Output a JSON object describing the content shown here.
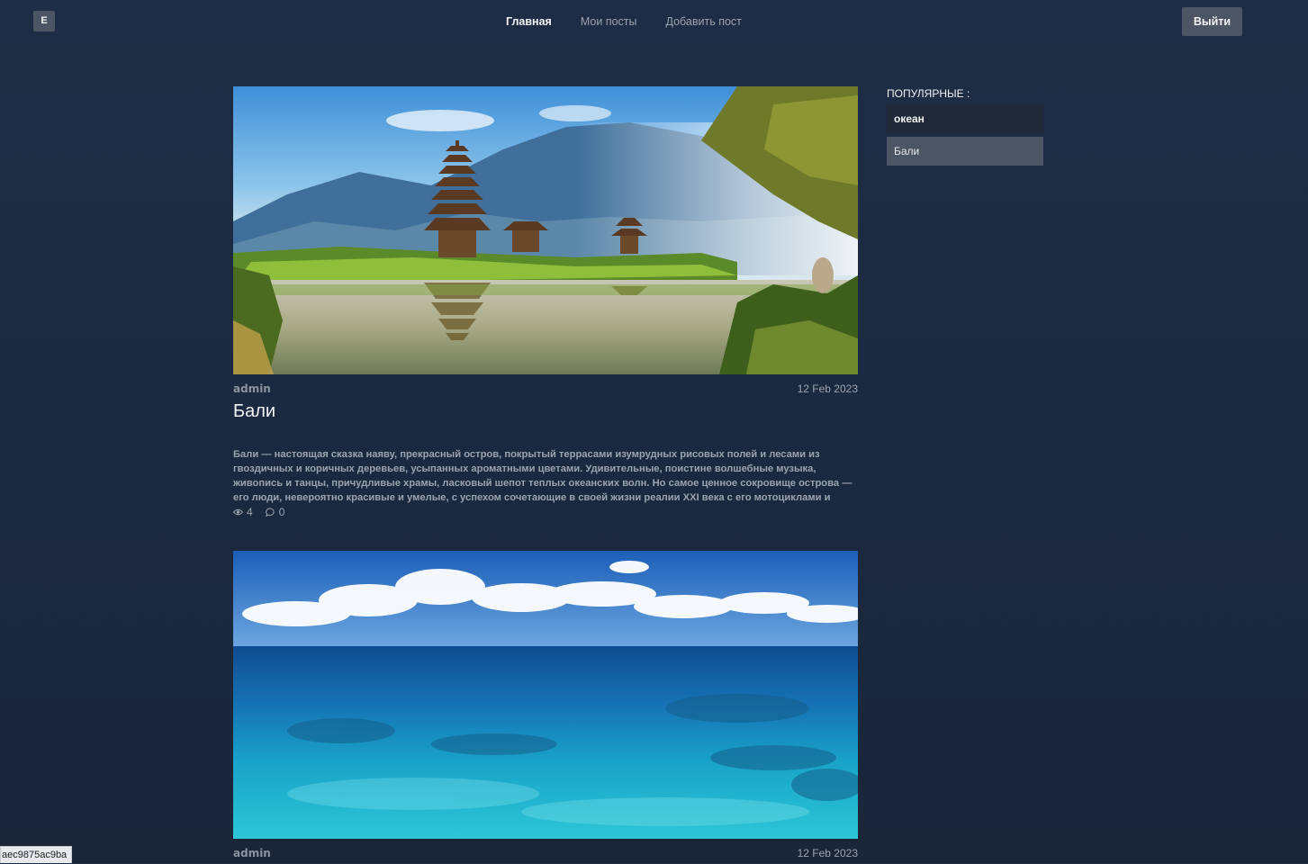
{
  "header": {
    "logo_letter": "E",
    "nav": [
      {
        "label": "Главная",
        "active": true
      },
      {
        "label": "Мои посты",
        "active": false
      },
      {
        "label": "Добавить пост",
        "active": false
      }
    ],
    "logout_label": "Выйти"
  },
  "posts": [
    {
      "image": "bali-temple-lake-photo",
      "author": "admin",
      "date": "12 Feb 2023",
      "title": "Бали",
      "excerpt": "Бали — настоящая сказка наяву, прекрасный остров, покрытый террасами изумрудных рисовых полей и лесами из гвоздичных и коричных деревьев, усыпанных ароматными цветами. Удивительные, поистине волшебные музыка, живопись и танцы, причудливые храмы, ласковый шепот теплых океанских волн. Но самое ценное сокровище острова — его люди, невероятно красивые и умелые, с успехом сочетающие в своей жизни реалии XXI века с его мотоциклами и интернет-каф...",
      "views": "4",
      "comments": "0"
    },
    {
      "image": "ocean-photo",
      "author": "admin",
      "date": "12 Feb 2023"
    }
  ],
  "sidebar": {
    "title": "ПОПУЛЯРНЫЕ :",
    "tags": [
      "океан",
      "Бали"
    ]
  },
  "status_bar": {
    "url_fragment": "aec9875ac9ba"
  },
  "colors": {
    "background": "#1e2c45",
    "button": "#4b5563",
    "tag_dark": "#1f2937"
  }
}
